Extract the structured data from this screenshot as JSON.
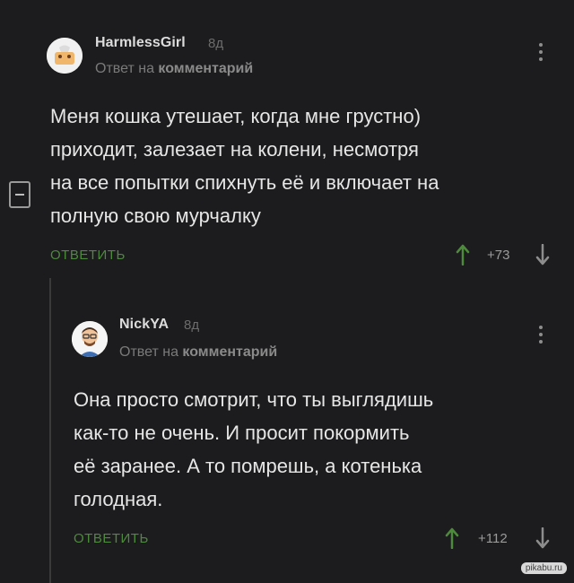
{
  "comments": [
    {
      "username": "HarmlessGirl",
      "time": "8д",
      "reply_prefix": "Ответ на",
      "reply_target": "комментарий",
      "lines": [
        "Меня кошка утешает, когда мне грустно)",
        "приходит, залезает на колени, несмотря",
        "на все попытки спихнуть её и включает на",
        "полную свою мурчалку"
      ],
      "reply_label": "ОТВЕТИТЬ",
      "rating": "+73"
    },
    {
      "username": "NickYA",
      "time": "8д",
      "reply_prefix": "Ответ на",
      "reply_target": "комментарий",
      "lines": [
        "Она просто смотрит, что ты выглядишь",
        "как-то не очень. И просит покормить",
        "её заранее. А то помрешь, а котенька",
        "голодная."
      ],
      "reply_label": "ОТВЕТИТЬ",
      "rating": "+112"
    }
  ],
  "watermark": "pikabu.ru",
  "colors": {
    "background": "#1c1c1e",
    "reply_link": "#4d8a3c",
    "vote_up": "#4d8a3c",
    "vote_down": "#8d8d8d"
  },
  "icons": [
    "kebab-menu-icon",
    "arrow-up-icon",
    "arrow-down-icon",
    "collapse-minus-icon"
  ]
}
